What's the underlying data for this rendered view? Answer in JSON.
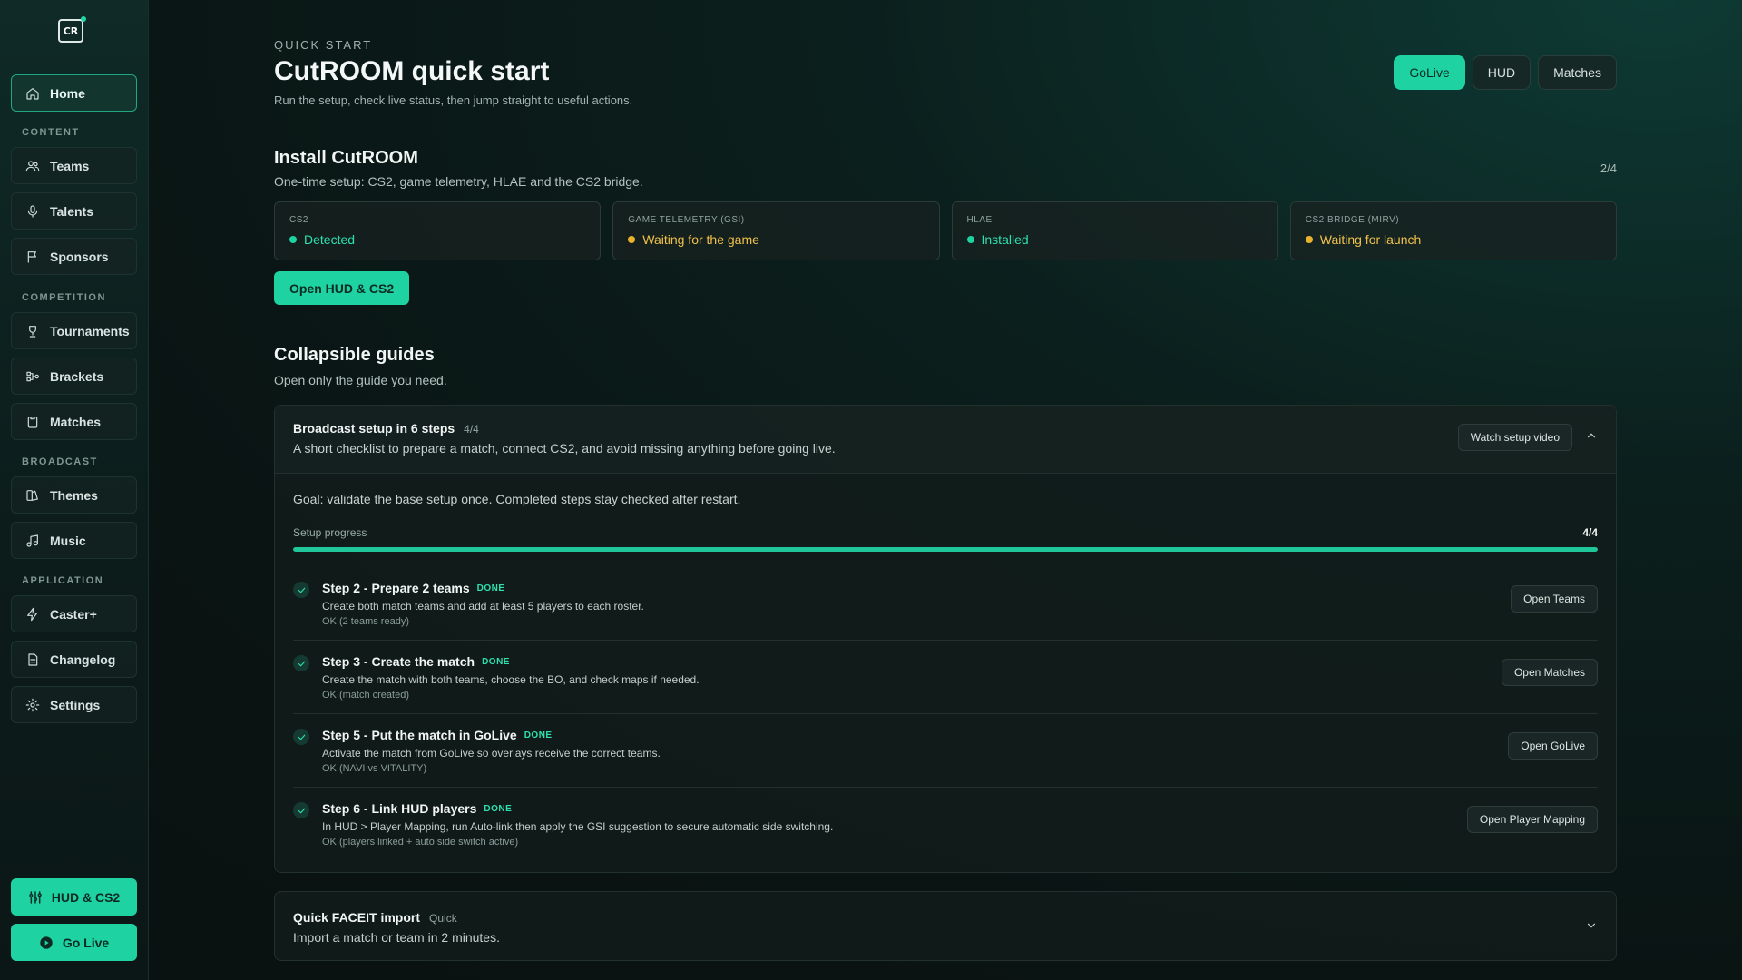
{
  "sidebar": {
    "logo_text": "CR",
    "home": "Home",
    "sections": {
      "content": "CONTENT",
      "competition": "COMPETITION",
      "broadcast": "BROADCAST",
      "application": "APPLICATION"
    },
    "items": {
      "teams": "Teams",
      "talents": "Talents",
      "sponsors": "Sponsors",
      "tournaments": "Tournaments",
      "brackets": "Brackets",
      "matches": "Matches",
      "themes": "Themes",
      "music": "Music",
      "caster": "Caster+",
      "changelog": "Changelog",
      "settings": "Settings"
    },
    "cta_hud": "HUD & CS2",
    "cta_golive": "Go Live"
  },
  "header": {
    "eyebrow": "QUICK START",
    "title": "CutROOM quick start",
    "subtitle": "Run the setup, check live status, then jump straight to useful actions.",
    "actions": {
      "golive": "GoLive",
      "hud": "HUD",
      "matches": "Matches"
    }
  },
  "install": {
    "title": "Install CutROOM",
    "subtitle": "One-time setup: CS2, game telemetry, HLAE and the CS2 bridge.",
    "counter": "2/4",
    "cards": [
      {
        "label": "CS2",
        "value": "Detected",
        "status": "green"
      },
      {
        "label": "GAME TELEMETRY (GSI)",
        "value": "Waiting for the game",
        "status": "amber"
      },
      {
        "label": "HLAE",
        "value": "Installed",
        "status": "green"
      },
      {
        "label": "CS2 BRIDGE (MIRV)",
        "value": "Waiting for launch",
        "status": "amber"
      }
    ],
    "cta": "Open HUD & CS2"
  },
  "guides": {
    "title": "Collapsible guides",
    "subtitle": "Open only the guide you need.",
    "broadcast": {
      "title": "Broadcast setup in 6 steps",
      "tag": "4/4",
      "desc": "A short checklist to prepare a match, connect CS2, and avoid missing anything before going live.",
      "watch_label": "Watch setup video",
      "goal": "Goal: validate the base setup once. Completed steps stay checked after restart.",
      "progress_label": "Setup progress",
      "progress_value": "4/4",
      "progress_fraction": 1.0,
      "done_label": "DONE",
      "steps": [
        {
          "title": "Step 2 - Prepare 2 teams",
          "desc": "Create both match teams and add at least 5 players to each roster.",
          "ok": "OK (2 teams ready)",
          "action": "Open Teams"
        },
        {
          "title": "Step 3 - Create the match",
          "desc": "Create the match with both teams, choose the BO, and check maps if needed.",
          "ok": "OK (match created)",
          "action": "Open Matches"
        },
        {
          "title": "Step 5 - Put the match in GoLive",
          "desc": "Activate the match from GoLive so overlays receive the correct teams.",
          "ok": "OK (NAVI vs VITALITY)",
          "action": "Open GoLive"
        },
        {
          "title": "Step 6 - Link HUD players",
          "desc": "In HUD > Player Mapping, run Auto-link then apply the GSI suggestion to secure automatic side switching.",
          "ok": "OK (players linked + auto side switch active)",
          "action": "Open Player Mapping"
        }
      ]
    },
    "faceit": {
      "title": "Quick FACEIT import",
      "tag": "Quick",
      "desc": "Import a match or team in 2 minutes."
    }
  },
  "colors": {
    "accent": "#1fd2a1",
    "warning": "#e8b22c",
    "background": "#0a1413"
  }
}
